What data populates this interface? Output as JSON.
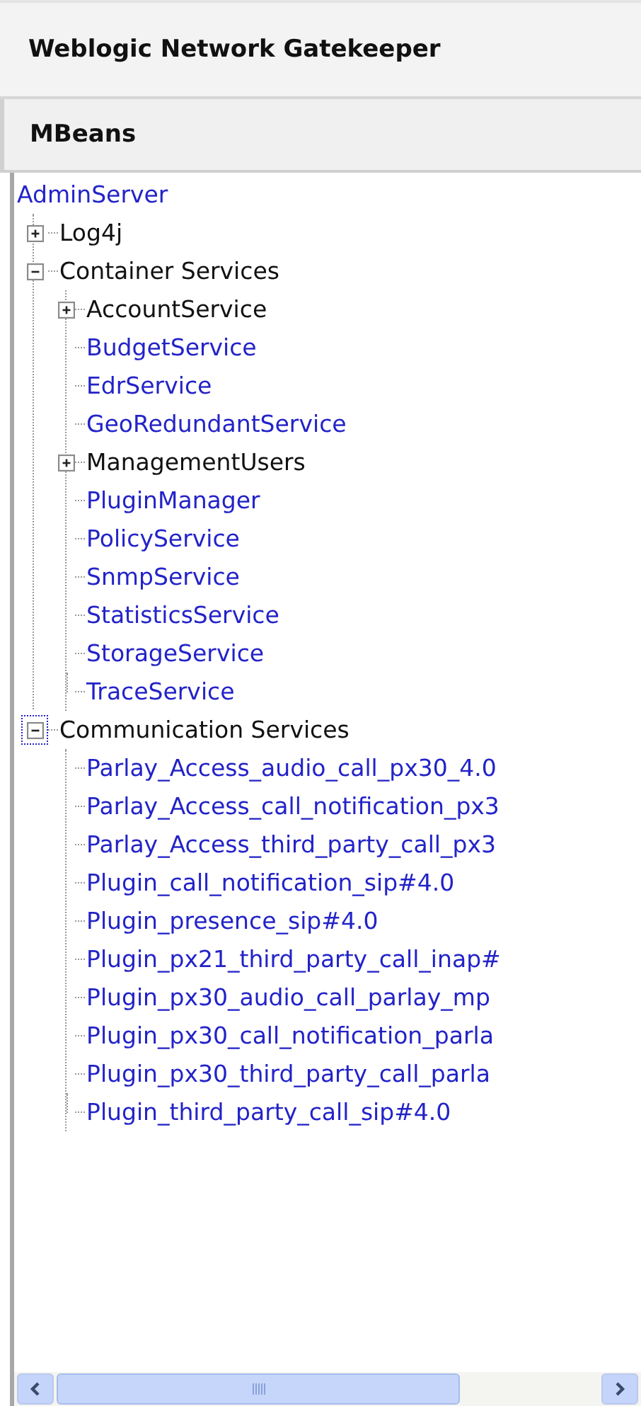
{
  "title": "Weblogic Network Gatekeeper",
  "panel_title": "MBeans",
  "tree": {
    "label": "AdminServer",
    "kind": "link",
    "children": [
      {
        "label": "Log4j",
        "kind": "group",
        "expanded": false,
        "focused": false
      },
      {
        "label": "Container Services",
        "kind": "group",
        "expanded": true,
        "focused": false,
        "children": [
          {
            "label": "AccountService",
            "kind": "group",
            "expanded": false
          },
          {
            "label": "BudgetService",
            "kind": "link"
          },
          {
            "label": "EdrService",
            "kind": "link"
          },
          {
            "label": "GeoRedundantService",
            "kind": "link"
          },
          {
            "label": "ManagementUsers",
            "kind": "group",
            "expanded": false
          },
          {
            "label": "PluginManager",
            "kind": "link"
          },
          {
            "label": "PolicyService",
            "kind": "link"
          },
          {
            "label": "SnmpService",
            "kind": "link"
          },
          {
            "label": "StatisticsService",
            "kind": "link"
          },
          {
            "label": "StorageService",
            "kind": "link"
          },
          {
            "label": "TraceService",
            "kind": "link"
          }
        ]
      },
      {
        "label": "Communication Services",
        "kind": "group",
        "expanded": true,
        "focused": true,
        "children": [
          {
            "label": "Parlay_Access_audio_call_px30_4.0",
            "kind": "link"
          },
          {
            "label": "Parlay_Access_call_notification_px3",
            "kind": "link"
          },
          {
            "label": "Parlay_Access_third_party_call_px3",
            "kind": "link"
          },
          {
            "label": "Plugin_call_notification_sip#4.0",
            "kind": "link"
          },
          {
            "label": "Plugin_presence_sip#4.0",
            "kind": "link"
          },
          {
            "label": "Plugin_px21_third_party_call_inap#",
            "kind": "link"
          },
          {
            "label": "Plugin_px30_audio_call_parlay_mp",
            "kind": "link"
          },
          {
            "label": "Plugin_px30_call_notification_parla",
            "kind": "link"
          },
          {
            "label": "Plugin_px30_third_party_call_parla",
            "kind": "link"
          },
          {
            "label": "Plugin_third_party_call_sip#4.0",
            "kind": "link"
          }
        ]
      }
    ]
  }
}
